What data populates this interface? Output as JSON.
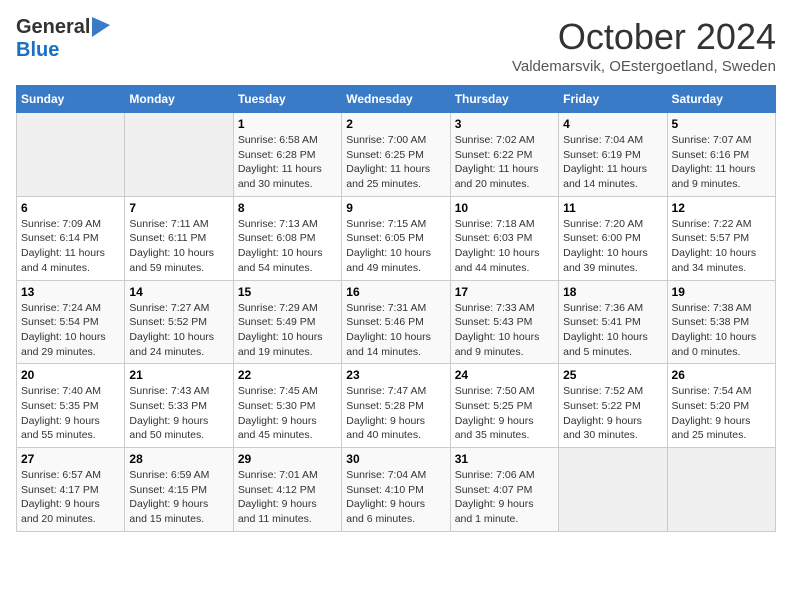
{
  "header": {
    "logo_line1": "General",
    "logo_line2": "Blue",
    "title": "October 2024",
    "subtitle": "Valdemarsvik, OEstergoetland, Sweden"
  },
  "weekdays": [
    "Sunday",
    "Monday",
    "Tuesday",
    "Wednesday",
    "Thursday",
    "Friday",
    "Saturday"
  ],
  "weeks": [
    [
      {
        "day": "",
        "info": ""
      },
      {
        "day": "",
        "info": ""
      },
      {
        "day": "1",
        "info": "Sunrise: 6:58 AM\nSunset: 6:28 PM\nDaylight: 11 hours\nand 30 minutes."
      },
      {
        "day": "2",
        "info": "Sunrise: 7:00 AM\nSunset: 6:25 PM\nDaylight: 11 hours\nand 25 minutes."
      },
      {
        "day": "3",
        "info": "Sunrise: 7:02 AM\nSunset: 6:22 PM\nDaylight: 11 hours\nand 20 minutes."
      },
      {
        "day": "4",
        "info": "Sunrise: 7:04 AM\nSunset: 6:19 PM\nDaylight: 11 hours\nand 14 minutes."
      },
      {
        "day": "5",
        "info": "Sunrise: 7:07 AM\nSunset: 6:16 PM\nDaylight: 11 hours\nand 9 minutes."
      }
    ],
    [
      {
        "day": "6",
        "info": "Sunrise: 7:09 AM\nSunset: 6:14 PM\nDaylight: 11 hours\nand 4 minutes."
      },
      {
        "day": "7",
        "info": "Sunrise: 7:11 AM\nSunset: 6:11 PM\nDaylight: 10 hours\nand 59 minutes."
      },
      {
        "day": "8",
        "info": "Sunrise: 7:13 AM\nSunset: 6:08 PM\nDaylight: 10 hours\nand 54 minutes."
      },
      {
        "day": "9",
        "info": "Sunrise: 7:15 AM\nSunset: 6:05 PM\nDaylight: 10 hours\nand 49 minutes."
      },
      {
        "day": "10",
        "info": "Sunrise: 7:18 AM\nSunset: 6:03 PM\nDaylight: 10 hours\nand 44 minutes."
      },
      {
        "day": "11",
        "info": "Sunrise: 7:20 AM\nSunset: 6:00 PM\nDaylight: 10 hours\nand 39 minutes."
      },
      {
        "day": "12",
        "info": "Sunrise: 7:22 AM\nSunset: 5:57 PM\nDaylight: 10 hours\nand 34 minutes."
      }
    ],
    [
      {
        "day": "13",
        "info": "Sunrise: 7:24 AM\nSunset: 5:54 PM\nDaylight: 10 hours\nand 29 minutes."
      },
      {
        "day": "14",
        "info": "Sunrise: 7:27 AM\nSunset: 5:52 PM\nDaylight: 10 hours\nand 24 minutes."
      },
      {
        "day": "15",
        "info": "Sunrise: 7:29 AM\nSunset: 5:49 PM\nDaylight: 10 hours\nand 19 minutes."
      },
      {
        "day": "16",
        "info": "Sunrise: 7:31 AM\nSunset: 5:46 PM\nDaylight: 10 hours\nand 14 minutes."
      },
      {
        "day": "17",
        "info": "Sunrise: 7:33 AM\nSunset: 5:43 PM\nDaylight: 10 hours\nand 9 minutes."
      },
      {
        "day": "18",
        "info": "Sunrise: 7:36 AM\nSunset: 5:41 PM\nDaylight: 10 hours\nand 5 minutes."
      },
      {
        "day": "19",
        "info": "Sunrise: 7:38 AM\nSunset: 5:38 PM\nDaylight: 10 hours\nand 0 minutes."
      }
    ],
    [
      {
        "day": "20",
        "info": "Sunrise: 7:40 AM\nSunset: 5:35 PM\nDaylight: 9 hours\nand 55 minutes."
      },
      {
        "day": "21",
        "info": "Sunrise: 7:43 AM\nSunset: 5:33 PM\nDaylight: 9 hours\nand 50 minutes."
      },
      {
        "day": "22",
        "info": "Sunrise: 7:45 AM\nSunset: 5:30 PM\nDaylight: 9 hours\nand 45 minutes."
      },
      {
        "day": "23",
        "info": "Sunrise: 7:47 AM\nSunset: 5:28 PM\nDaylight: 9 hours\nand 40 minutes."
      },
      {
        "day": "24",
        "info": "Sunrise: 7:50 AM\nSunset: 5:25 PM\nDaylight: 9 hours\nand 35 minutes."
      },
      {
        "day": "25",
        "info": "Sunrise: 7:52 AM\nSunset: 5:22 PM\nDaylight: 9 hours\nand 30 minutes."
      },
      {
        "day": "26",
        "info": "Sunrise: 7:54 AM\nSunset: 5:20 PM\nDaylight: 9 hours\nand 25 minutes."
      }
    ],
    [
      {
        "day": "27",
        "info": "Sunrise: 6:57 AM\nSunset: 4:17 PM\nDaylight: 9 hours\nand 20 minutes."
      },
      {
        "day": "28",
        "info": "Sunrise: 6:59 AM\nSunset: 4:15 PM\nDaylight: 9 hours\nand 15 minutes."
      },
      {
        "day": "29",
        "info": "Sunrise: 7:01 AM\nSunset: 4:12 PM\nDaylight: 9 hours\nand 11 minutes."
      },
      {
        "day": "30",
        "info": "Sunrise: 7:04 AM\nSunset: 4:10 PM\nDaylight: 9 hours\nand 6 minutes."
      },
      {
        "day": "31",
        "info": "Sunrise: 7:06 AM\nSunset: 4:07 PM\nDaylight: 9 hours\nand 1 minute."
      },
      {
        "day": "",
        "info": ""
      },
      {
        "day": "",
        "info": ""
      }
    ]
  ]
}
